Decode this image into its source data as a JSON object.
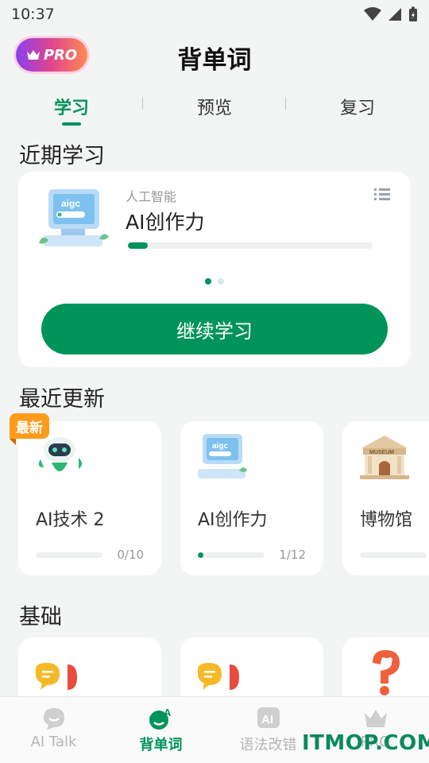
{
  "status_bar": {
    "time": "10:37"
  },
  "header": {
    "pro_label": "PRO",
    "title": "背单词"
  },
  "tabs": [
    {
      "label": "学习",
      "active": true
    },
    {
      "label": "预览",
      "active": false
    },
    {
      "label": "复习",
      "active": false
    }
  ],
  "recent": {
    "section_title": "近期学习",
    "category": "人工智能",
    "course_name": "AI创作力",
    "progress": 0.08,
    "page_dots": 2,
    "active_dot": 0,
    "continue_label": "继续学习"
  },
  "updates": {
    "section_title": "最近更新",
    "new_badge": "最新",
    "cards": [
      {
        "name": "AI技术 2",
        "count": "0/10",
        "progress": 0.0,
        "icon": "robot-illustration"
      },
      {
        "name": "AI创作力",
        "count": "1/12",
        "progress": 0.08,
        "icon": "computer-illustration"
      },
      {
        "name": "博物馆",
        "count": "",
        "progress": 0.0,
        "icon": "museum-illustration"
      }
    ]
  },
  "basics": {
    "section_title": "基础",
    "cards": [
      {
        "icon": "chat-bubble-flag-illustration"
      },
      {
        "icon": "chat-bubble-flag-illustration"
      },
      {
        "icon": "question-mark-illustration"
      }
    ]
  },
  "bottom_nav": [
    {
      "label": "AI Talk",
      "icon": "chat-icon",
      "active": false
    },
    {
      "label": "背单词",
      "icon": "vocab-icon",
      "active": true
    },
    {
      "label": "语法改错",
      "icon": "ai-grammar-icon",
      "active": false
    },
    {
      "label": "PRO",
      "icon": "crown-icon",
      "active": false
    }
  ],
  "watermark": "ITMOP.COM",
  "colors": {
    "accent": "#00935a",
    "badge": "#ff9b1a"
  }
}
